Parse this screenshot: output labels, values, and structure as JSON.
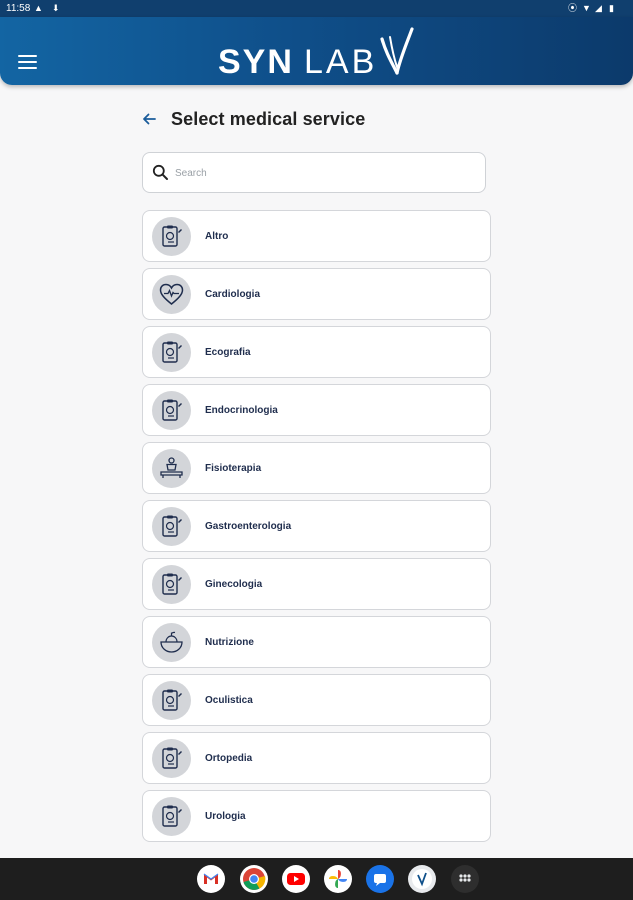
{
  "status_bar": {
    "time": "11:58",
    "icons": [
      "alert-triangle-icon",
      "download-icon",
      "location-icon",
      "wifi-icon",
      "signal-icon",
      "battery-icon"
    ]
  },
  "app_bar": {
    "logo_bold": "SYN",
    "logo_light": "LAB",
    "brand_color": "#0f4f8a"
  },
  "page": {
    "title": "Select medical service",
    "search_placeholder": "Search"
  },
  "services": [
    {
      "label": "Altro",
      "icon": "clipboard-icon"
    },
    {
      "label": "Cardiologia",
      "icon": "heart-icon"
    },
    {
      "label": "Ecografia",
      "icon": "clipboard-icon"
    },
    {
      "label": "Endocrinologia",
      "icon": "clipboard-icon"
    },
    {
      "label": "Fisioterapia",
      "icon": "physiotherapy-icon"
    },
    {
      "label": "Gastroenterologia",
      "icon": "clipboard-icon"
    },
    {
      "label": "Ginecologia",
      "icon": "clipboard-icon"
    },
    {
      "label": "Nutrizione",
      "icon": "nutrition-bowl-icon"
    },
    {
      "label": "Oculistica",
      "icon": "clipboard-icon"
    },
    {
      "label": "Ortopedia",
      "icon": "clipboard-icon"
    },
    {
      "label": "Urologia",
      "icon": "clipboard-icon"
    }
  ],
  "dock": [
    "gmail-icon",
    "chrome-icon",
    "youtube-icon",
    "photos-icon",
    "messages-icon",
    "synlab-app-icon",
    "app-drawer-icon"
  ]
}
